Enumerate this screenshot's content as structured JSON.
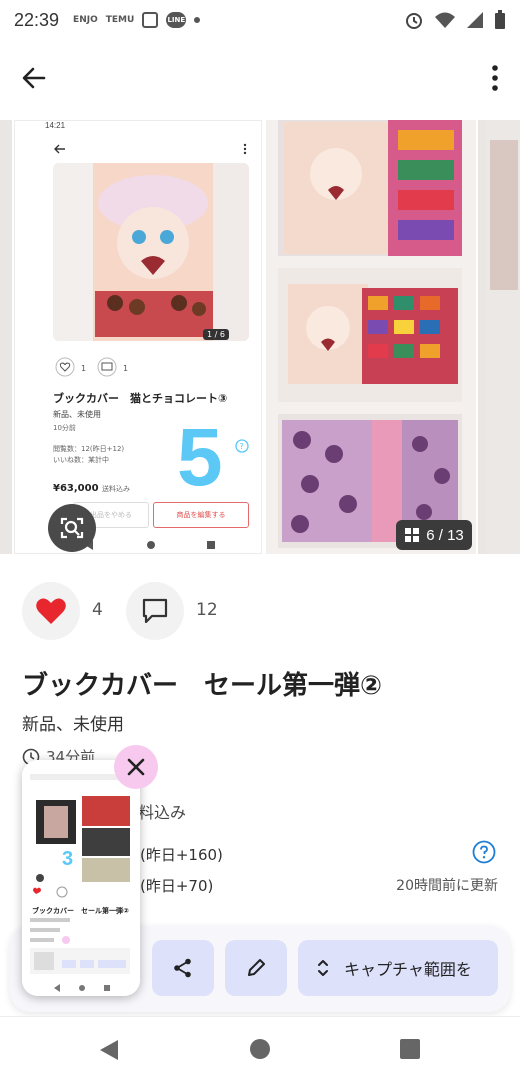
{
  "status_bar": {
    "time": "22:39",
    "app_icons": [
      "ENJO",
      "TEMU",
      "B",
      "LINE"
    ]
  },
  "gallery": {
    "counter": "6 / 13",
    "inner_screenshot": {
      "status_time": "14:21",
      "counter": "1 / 6",
      "like_count": "1",
      "comment_count": "1",
      "title": "ブックカバー　猫とチョコレート③",
      "condition": "新品、未使用",
      "posted": "10分前",
      "views": "閲覧数：12(昨日+12)",
      "likes": "いいね数：某計中",
      "price": "¥63,000",
      "price_tax": "送料込み",
      "overlay_number": "5",
      "other_button": "出品をやめる",
      "edit_button": "商品を編集する"
    }
  },
  "reactions": {
    "like_count": "4",
    "comment_count": "12"
  },
  "item": {
    "title": "ブックカバー　セール第一弾②",
    "condition": "新品、未使用",
    "posted": "34分前",
    "price_tax_partial": "料込み",
    "views_partial": "(昨日+160)",
    "likes_partial": "(昨日+70)",
    "updated": "20時間前に更新"
  },
  "preview": {
    "overlay_number": "3",
    "title": "ブックカバー　セール第一弾②"
  },
  "toolbar": {
    "capture_label": "キャプチャ範囲を"
  },
  "colors": {
    "like_red": "#e8262e",
    "toolbar_button": "#dde1fa",
    "close_pink": "#f8c9ef",
    "help_blue": "#1e7fd6",
    "overlay_blue": "#5bc8f5"
  }
}
